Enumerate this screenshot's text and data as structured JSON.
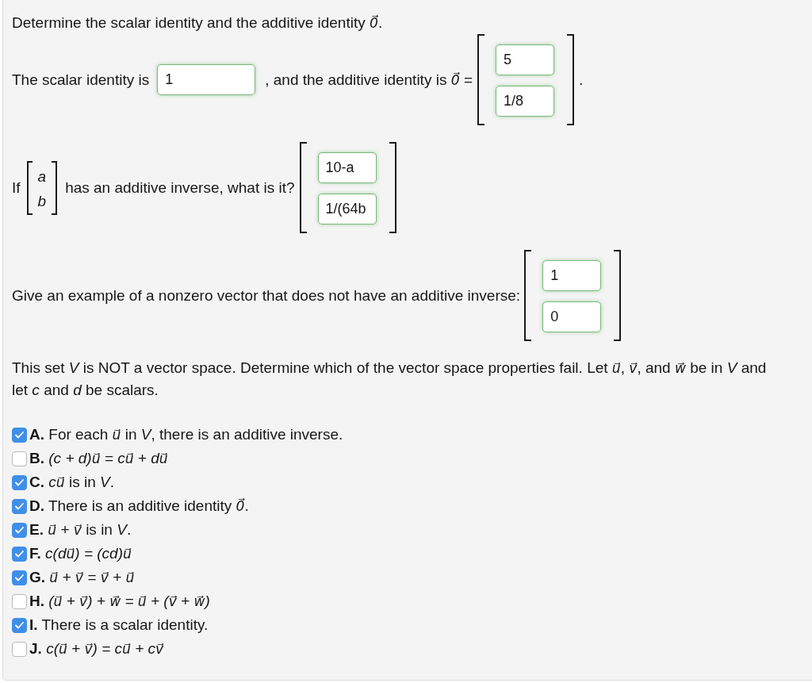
{
  "part_1": {
    "prompt": "Determine the scalar identity and the additive identity *0⃗*.",
    "scalar_label": "The scalar identity is",
    "scalar_answer": {
      "value": "1",
      "correct": true
    },
    "zero_label": ", and the additive identity is *0⃗ =*",
    "zero_answer": [
      {
        "value": "5",
        "correct": true
      },
      {
        "value": "1/8",
        "correct": true
      }
    ],
    "end": "."
  },
  "part_2": {
    "if_label": "If",
    "vector": [
      "*a*",
      "*b*"
    ],
    "question": "has an additive inverse, what is it?",
    "answer": [
      {
        "value": "10-a",
        "correct": true
      },
      {
        "value": "1/(64b",
        "correct": true
      }
    ]
  },
  "part_3": {
    "prompt": "Give an example of a nonzero vector that does not have an additive inverse:",
    "answer": [
      {
        "value": "1",
        "correct": true
      },
      {
        "value": "0",
        "correct": true
      }
    ]
  },
  "part_4": {
    "prompt": "This set *V* is NOT a vector space. Determine which of the vector space properties fail. Let *u⃗*, *v⃗*, and *w⃗* be in *V* and let *c* and *d* be scalars.",
    "options": [
      {
        "text": "**A.** For each *u⃗* in *V*, there is an additive inverse.",
        "checked": true
      },
      {
        "text": "**B.** *(c + d)u⃗ = cu⃗ + du⃗*",
        "checked": false
      },
      {
        "text": "**C.** *cu⃗* is in *V*.",
        "checked": true
      },
      {
        "text": "**D.** There is an additive identity *0⃗*.",
        "checked": true
      },
      {
        "text": "**E.** *u⃗ + v⃗* is in *V*.",
        "checked": true
      },
      {
        "text": "**F.** *c(du⃗) = (cd)u⃗*",
        "checked": true
      },
      {
        "text": "**G.** *u⃗ + v⃗ = v⃗ + u⃗*",
        "checked": true
      },
      {
        "text": "**H.** *(u⃗ + v⃗) + w⃗ = u⃗ + (v⃗ + w⃗)*",
        "checked": false
      },
      {
        "text": "**I.** There is a scalar identity.",
        "checked": true
      },
      {
        "text": "**J.** *c(u⃗ + v⃗) = cu⃗ + cv⃗*",
        "checked": false
      }
    ]
  }
}
